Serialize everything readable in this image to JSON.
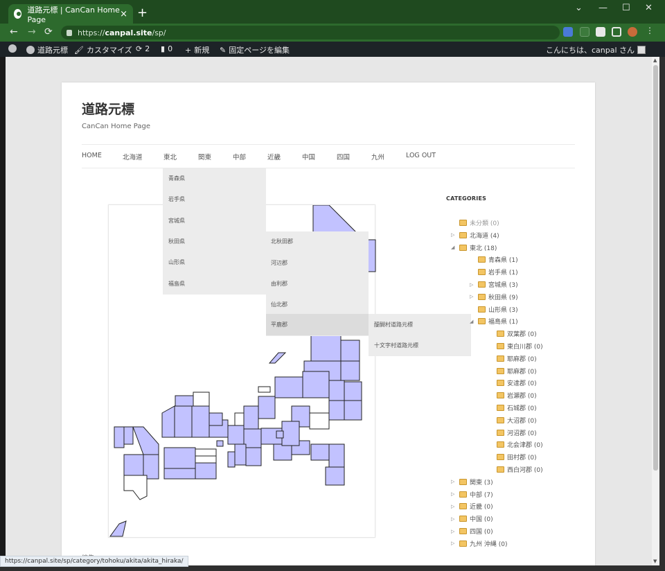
{
  "browser": {
    "tab_title": "道路元標 | CanCan Home Page",
    "tab_close": "×",
    "new_tab": "+",
    "url_scheme": "https://",
    "url_host": "canpal.site",
    "url_path": "/sp/",
    "window_controls": [
      "⌄",
      "—",
      "☐",
      "✕"
    ],
    "nav": {
      "back": "←",
      "forward": "→",
      "reload": "⟳"
    },
    "status_url": "https://canpal.site/sp/category/tohoku/akita/akita_hiraka/"
  },
  "adminbar": {
    "site_name": "道路元標",
    "customize": "カスタマイズ",
    "updates_count": "2",
    "comments_count": "0",
    "new_label": "新規",
    "edit_page": "固定ページを編集",
    "greeting": "こんにちは、canpal さん"
  },
  "site": {
    "title": "道路元標",
    "description": "CanCan Home Page"
  },
  "menu": {
    "items": [
      "HOME",
      "北海道",
      "東北",
      "関東",
      "中部",
      "近畿",
      "中国",
      "四国",
      "九州",
      "LOG OUT"
    ],
    "tohoku_submenu": [
      "青森県",
      "岩手県",
      "宮城県",
      "秋田県",
      "山形県",
      "福島県"
    ],
    "akita_submenu": [
      "北秋田郡",
      "河辺郡",
      "由利郡",
      "仙北郡",
      "平鹿郡"
    ],
    "hiraka_submenu": [
      "醍醐村道路元標",
      "十文字村道路元標"
    ]
  },
  "sidebar": {
    "heading": "CATEGORIES",
    "categories": [
      {
        "label": "未分類 (0)",
        "toggle": "",
        "level": 0,
        "dim": true
      },
      {
        "label": "北海道 (4)",
        "toggle": "▷",
        "level": 0
      },
      {
        "label": "東北 (18)",
        "toggle": "◢",
        "level": 0
      },
      {
        "label": "青森県 (1)",
        "toggle": "",
        "level": 1
      },
      {
        "label": "岩手県 (1)",
        "toggle": "",
        "level": 1
      },
      {
        "label": "宮城県 (3)",
        "toggle": "▷",
        "level": 1
      },
      {
        "label": "秋田県 (9)",
        "toggle": "▷",
        "level": 1
      },
      {
        "label": "山形県 (3)",
        "toggle": "",
        "level": 1
      },
      {
        "label": "福島県 (1)",
        "toggle": "◢",
        "level": 1
      },
      {
        "label": "双葉郡 (0)",
        "toggle": "",
        "level": 2
      },
      {
        "label": "東白川郡 (0)",
        "toggle": "",
        "level": 2
      },
      {
        "label": "耶麻郡 (0)",
        "toggle": "",
        "level": 2
      },
      {
        "label": "耶麻郡 (0)",
        "toggle": "",
        "level": 2
      },
      {
        "label": "安達郡 (0)",
        "toggle": "",
        "level": 2
      },
      {
        "label": "岩瀬郡 (0)",
        "toggle": "",
        "level": 2
      },
      {
        "label": "石城郡 (0)",
        "toggle": "",
        "level": 2
      },
      {
        "label": "大沼郡 (0)",
        "toggle": "",
        "level": 2
      },
      {
        "label": "河沼郡 (0)",
        "toggle": "",
        "level": 2
      },
      {
        "label": "北会津郡 (0)",
        "toggle": "",
        "level": 2
      },
      {
        "label": "田村郡 (0)",
        "toggle": "",
        "level": 2
      },
      {
        "label": "西白河郡 (0)",
        "toggle": "",
        "level": 2
      },
      {
        "label": "関東 (3)",
        "toggle": "▷",
        "level": 0
      },
      {
        "label": "中部 (7)",
        "toggle": "▷",
        "level": 0
      },
      {
        "label": "近畿 (0)",
        "toggle": "▷",
        "level": 0
      },
      {
        "label": "中国 (0)",
        "toggle": "▷",
        "level": 0
      },
      {
        "label": "四国 (0)",
        "toggle": "▷",
        "level": 0
      },
      {
        "label": "九州 沖縄 (0)",
        "toggle": "▷",
        "level": 0
      }
    ]
  },
  "archive_label": "編集",
  "colors": {
    "map_fill": "#c2c2ff",
    "map_stroke": "#222222",
    "chrome_green": "#2d6a2d",
    "adminbar_bg": "#1d2327"
  }
}
